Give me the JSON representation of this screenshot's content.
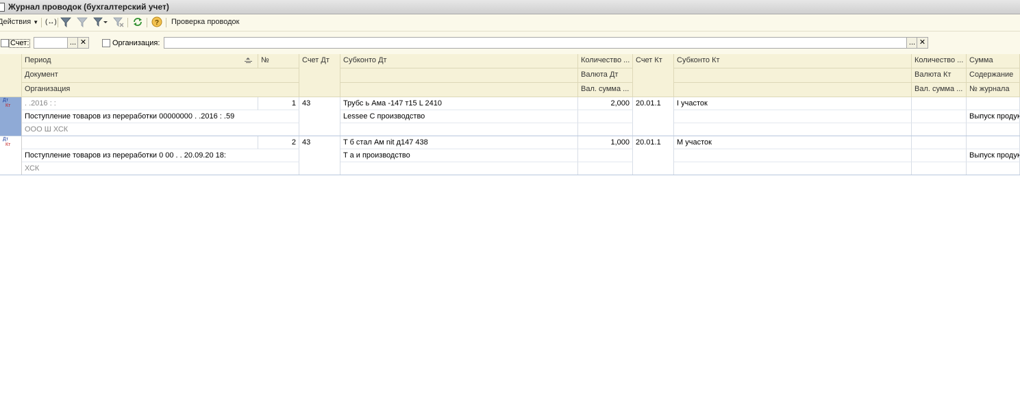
{
  "window": {
    "title": "Журнал проводок (бухгалтерский учет)"
  },
  "toolbar": {
    "actions_label": "Действия",
    "check_label": "Проверка проводок",
    "icons": [
      "exchange-icon",
      "filter-icon",
      "filter-off-icon",
      "filter-dropdown-icon",
      "filter-clear-icon",
      "refresh-icon",
      "help-icon"
    ]
  },
  "filters": {
    "account_label": "Счет:",
    "account_value": "",
    "org_label": "Организация:",
    "org_value": "",
    "select_glyph": "...",
    "clear_glyph": "✕"
  },
  "columns": {
    "period": "Период",
    "num": "№",
    "acc_dt": "Счет Дт",
    "subconto_dt": "Субконто Дт",
    "qty_dt": "Количество ...",
    "acc_kt": "Счет Кт",
    "subconto_kt": "Субконто Кт",
    "qty_kt": "Количество ...",
    "sum": "Сумма",
    "document": "Документ",
    "currency_dt": "Валюта Дт",
    "currency_kt": "Валюта Кт",
    "content": "Содержание",
    "organization": "Организация",
    "cur_sum_dt": "Вал. сумма ...",
    "cur_sum_kt": "Вал. сумма ...",
    "journal": "№ журнала"
  },
  "rows": [
    {
      "icon": "dt-kt-icon",
      "period": "  .  .2016  : :  ",
      "num": "1",
      "acc_dt": "43",
      "subconto_dt": "Трубс      ь Ама    -147 т15 L 2410",
      "qty_dt": "2,000",
      "acc_kt": "20.01.1",
      "subconto_kt": "I                                участок",
      "document": "Поступление товаров из переработки 00000000          .  .2016  :  .59",
      "subconto_dt_2": "Lessee   С  производство",
      "content": "Выпуск продук",
      "organization": "ООО  Ш      ХСК"
    },
    {
      "icon": "dt-kt-icon",
      "period": "",
      "num": "2",
      "acc_dt": "43",
      "subconto_dt": "T    б стал  Ам     nit д147          438",
      "qty_dt": "1,000",
      "acc_kt": "20.01.1",
      "subconto_kt": "M                                  участок",
      "document": "Поступление товаров из переработки  0     00   .  .  20.09.20    18:  ",
      "subconto_dt_2": "T    а    и     производство",
      "content": "Выпуск продук",
      "organization": "          ХСК"
    }
  ]
}
